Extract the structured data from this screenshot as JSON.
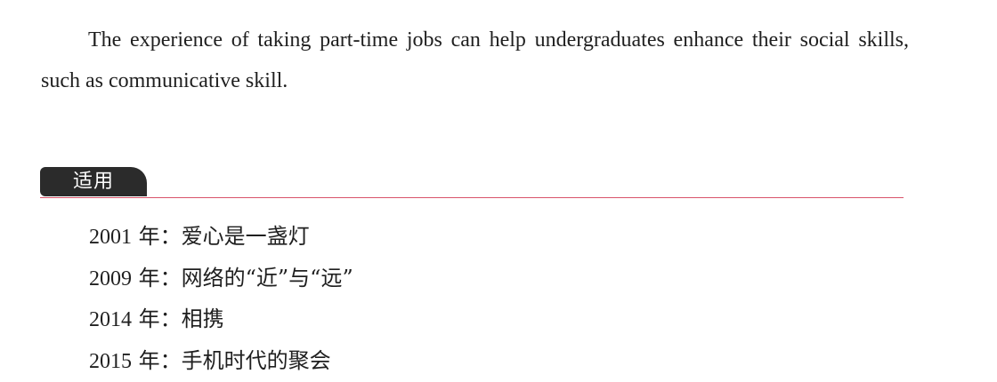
{
  "paragraph": {
    "text": "The experience of taking part-time jobs can help undergraduates enhance their social skills, such as communicative skill."
  },
  "section": {
    "label": "适用"
  },
  "years": [
    {
      "year": "2001",
      "suffix": " 年：",
      "title": "爱心是一盏灯"
    },
    {
      "year": "2009",
      "suffix": " 年：",
      "title": "网络的“近”与“远”"
    },
    {
      "year": "2014",
      "suffix": " 年：",
      "title": "相携"
    },
    {
      "year": "2015",
      "suffix": " 年：",
      "title": "手机时代的聚会"
    }
  ]
}
